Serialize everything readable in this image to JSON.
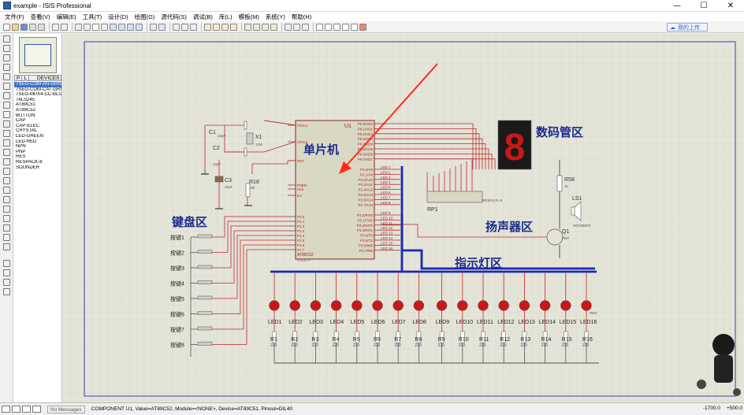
{
  "window": {
    "title": "example - ISIS Professional",
    "min": "—",
    "max": "☐",
    "close": "✕"
  },
  "menu": [
    "文件(F)",
    "查看(V)",
    "编辑(E)",
    "工具(T)",
    "设计(D)",
    "绘图(G)",
    "源代码(S)",
    "调试(B)",
    "库(L)",
    "模板(M)",
    "系统(Y)",
    "帮助(H)"
  ],
  "cloud_button": "我的上传",
  "device_panel": {
    "tab_p": "P",
    "tab_l": "L",
    "header": "DEVICES",
    "items": [
      "7SEG-COM-AN-GRN",
      "7SEG-COM-CAT-GRN",
      "7SEG-MPX4-CC-BLUE",
      "74LS245",
      "AT89C51",
      "AT89C52",
      "BUTTON",
      "CAP",
      "CAP-ELEC",
      "CRYSTAL",
      "LED-GREEN",
      "LED-RED",
      "NPN",
      "PNP",
      "RES",
      "RESPACK-8",
      "SOUNDER"
    ],
    "selected_index": 0
  },
  "schematic": {
    "labels": {
      "mcu": "单片机",
      "seg_display": "数码管区",
      "keypad": "键盘区",
      "speaker": "扬声器区",
      "indicator": "指示灯区"
    },
    "mcu_ref": "U1",
    "mcu_type": "AT89C52",
    "text_tag": "<TEXT>",
    "mcu_left_pins": [
      "XTAL1",
      "XTAL2",
      "RST",
      "PSEN",
      "ALE",
      "EA",
      "P1.0",
      "P1.1",
      "P1.2",
      "P1.3",
      "P1.4",
      "P1.5",
      "P1.6",
      "P1.7"
    ],
    "mcu_right_pins": [
      "P0.0/AD0",
      "P0.1/AD1",
      "P0.2/AD2",
      "P0.3/AD3",
      "P0.4/AD4",
      "P0.5/AD5",
      "P0.6/AD6",
      "P0.7/AD7",
      "P2.0/A8",
      "P2.1/A9",
      "P2.2/A10",
      "P2.3/A11",
      "P2.4/A12",
      "P2.5/A13",
      "P2.6/A14",
      "P2.7/A15",
      "P3.0/RXD",
      "P3.1/TXD",
      "P3.2/INT0",
      "P3.3/INT1",
      "P3.4/T0",
      "P3.5/T1",
      "P3.6/WR",
      "P3.7/RD"
    ],
    "parts": {
      "c1": "C1",
      "c1_val": "22pF",
      "c2": "C2",
      "c2_val": "22pF",
      "c3": "C3",
      "c3_val": "10uF",
      "x1": "X1",
      "x1_val": "12M",
      "r18": "R18",
      "r18_val": "10k",
      "r58": "R58",
      "r58_val": "1k",
      "rp1": "RP1",
      "rp1_type": "RESPACK-8",
      "ls1": "LS1",
      "ls1_type": "SOUNDER",
      "q1": "Q1",
      "q1_type": "PNP",
      "seg_digit": "8"
    },
    "buttons": [
      "按键1",
      "按键2",
      "按键3",
      "按键4",
      "按键5",
      "按键6",
      "按键7",
      "按键8"
    ],
    "leds": [
      "LED1",
      "LED2",
      "LED3",
      "LED4",
      "LED5",
      "LED6",
      "LED7",
      "LED8",
      "LED9",
      "LED10",
      "LED11",
      "LED12",
      "LED13",
      "LED14",
      "LED15",
      "LED16"
    ],
    "led_type": "RED",
    "resistors": [
      "R1",
      "R2",
      "R3",
      "R4",
      "R5",
      "R6",
      "R7",
      "R8",
      "R9",
      "R10",
      "R11",
      "R12",
      "R13",
      "R14",
      "R15",
      "R16"
    ],
    "resistor_val": "220",
    "bus_labels_top": [
      "LED 1",
      "LED 2",
      "LED 3",
      "LED 4",
      "LED 5",
      "LED 6",
      "LED 7",
      "LED 8"
    ],
    "bus_labels_bottom": [
      "LED 9",
      "LED 10",
      "LED 11",
      "LED 12",
      "LED 13",
      "LED 14",
      "LED 15",
      "LED 16"
    ]
  },
  "status": {
    "messages": "No Messages",
    "component": "COMPONENT U1, Value=AT89C52, Module=<NONE>, Device=AT89C51, Pinout=DIL40",
    "x": "-1700.0",
    "y": "+500.0"
  },
  "colors": {
    "wire": "#c0282d",
    "bus": "#1b27b5",
    "canvas": "#e4e4d8",
    "grid": "#cfcfbf",
    "component": "#8b2020",
    "label": "#1b2a8c",
    "seg_red": "#c81818",
    "arrow": "#ff2a1a"
  }
}
